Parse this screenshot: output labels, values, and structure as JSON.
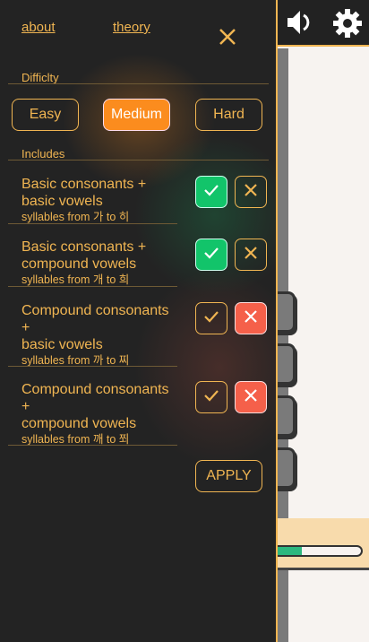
{
  "nav": {
    "about": "about",
    "theory": "theory"
  },
  "difficulty": {
    "heading": "Difficlty",
    "options": [
      "Easy",
      "Medium",
      "Hard"
    ],
    "selected": "Medium"
  },
  "includes": {
    "heading": "Includes",
    "items": [
      {
        "title": "Basic consonants + basic vowels",
        "lines": [
          "Basic consonants +",
          "basic vowels"
        ],
        "subtitle": "syllables from 가 to 히",
        "checked": true
      },
      {
        "title": "Basic consonants + compound vowels",
        "lines": [
          "Basic consonants +",
          "compound vowels"
        ],
        "subtitle": "syllables from 개 to 희",
        "checked": true
      },
      {
        "title": "Compound consonants + basic vowels",
        "lines": [
          "Compound consonants",
          "+",
          "basic vowels"
        ],
        "subtitle": "syllables from 까 to 찌",
        "checked": false
      },
      {
        "title": "Compound consonants + compound vowels",
        "lines": [
          "Compound consonants",
          "+",
          "compound vowels"
        ],
        "subtitle": "syllables from 깨 to 쬐",
        "checked": false
      }
    ]
  },
  "apply_label": "APPLY",
  "progress": 0.35,
  "colors": {
    "accent": "#f0b552",
    "selected": "#fb8c1e",
    "on": "#12c46a",
    "off": "#f5604a"
  }
}
